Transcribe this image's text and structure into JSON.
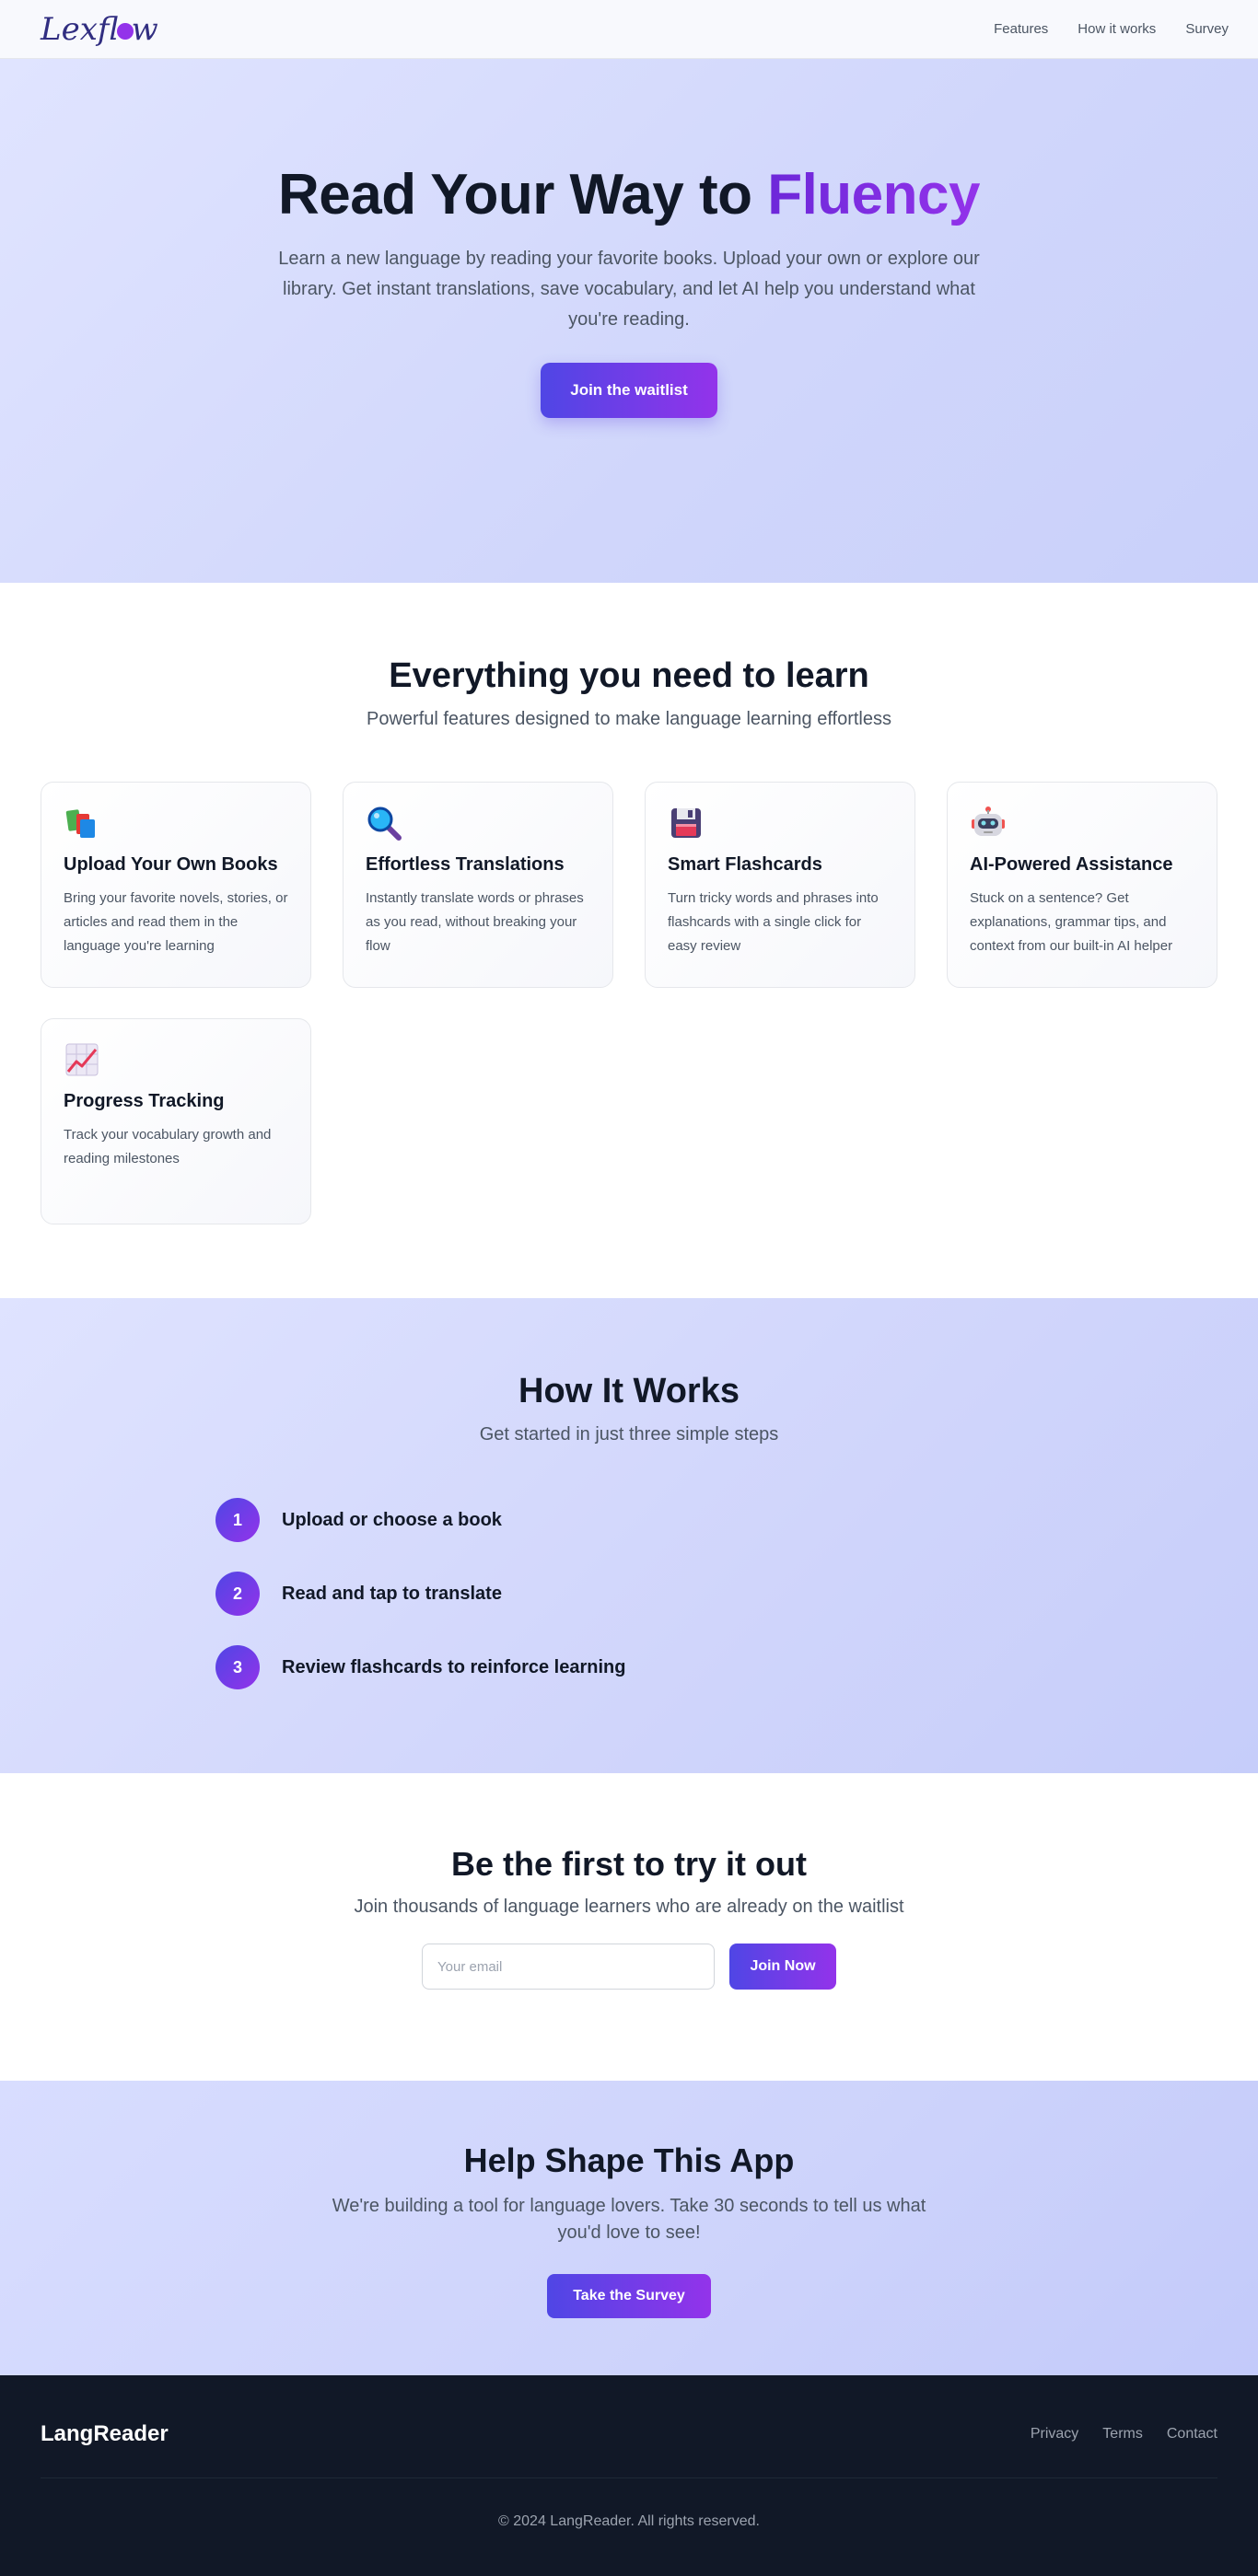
{
  "nav": {
    "logo_left": "Lexfl",
    "logo_right": "w",
    "links": [
      "Features",
      "How it works",
      "Survey"
    ]
  },
  "hero": {
    "title_main": "Read Your Way to ",
    "title_accent": "Fluency",
    "subtitle": "Learn a new language by reading your favorite books. Upload your own or explore our library. Get instant translations, save vocabulary, and let AI help you understand what you're reading.",
    "cta": "Join the waitlist"
  },
  "features": {
    "title": "Everything you need to learn",
    "subtitle": "Powerful features designed to make language learning effortless",
    "cards": [
      {
        "icon": "books-icon",
        "title": "Upload Your Own Books",
        "desc": "Bring your favorite novels, stories, or articles and read them in the language you're learning"
      },
      {
        "icon": "magnifier-icon",
        "title": "Effortless Translations",
        "desc": "Instantly translate words or phrases as you read, without breaking your flow"
      },
      {
        "icon": "floppy-disk-icon",
        "title": "Smart Flashcards",
        "desc": "Turn tricky words and phrases into flashcards with a single click for easy review"
      },
      {
        "icon": "robot-icon",
        "title": "AI-Powered Assistance",
        "desc": "Stuck on a sentence? Get explanations, grammar tips, and context from our built-in AI helper"
      },
      {
        "icon": "chart-up-icon",
        "title": "Progress Tracking",
        "desc": "Track your vocabulary growth and reading milestones"
      }
    ]
  },
  "how": {
    "title": "How It Works",
    "subtitle": "Get started in just three simple steps",
    "steps": [
      {
        "num": "1",
        "label": "Upload or choose a book"
      },
      {
        "num": "2",
        "label": "Read and tap to translate"
      },
      {
        "num": "3",
        "label": "Review flashcards to reinforce learning"
      }
    ]
  },
  "waitlist": {
    "title": "Be the first to try it out",
    "subtitle": "Join thousands of language learners who are already on the waitlist",
    "placeholder": "Your email",
    "button": "Join Now"
  },
  "survey": {
    "title": "Help Shape This App",
    "subtitle": "We're building a tool for language lovers. Take 30 seconds to tell us what you'd love to see!",
    "button": "Take the Survey"
  },
  "footer": {
    "brand": "LangReader",
    "links": [
      "Privacy",
      "Terms",
      "Contact"
    ],
    "copyright": "© 2024 LangReader. All rights reserved."
  }
}
